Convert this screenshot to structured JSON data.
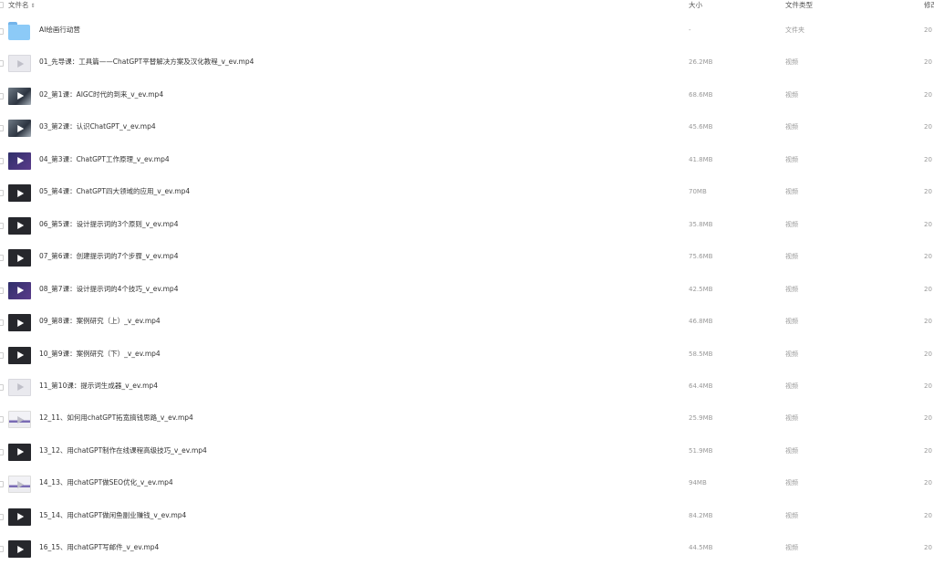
{
  "header": {
    "name": "文件名",
    "size": "大小",
    "type": "文件类型",
    "modified": "修改"
  },
  "rows": [
    {
      "name": "AI绘画行动营",
      "size": "-",
      "type": "文件夹",
      "date": "20",
      "thumb": "folder"
    },
    {
      "name": "01_先导课：工具篇——ChatGPT平替解决方案及汉化教程_v_ev.mp4",
      "size": "26.2MB",
      "type": "视频",
      "date": "20",
      "thumb": "light"
    },
    {
      "name": "02_第1课：AIGC时代的到来_v_ev.mp4",
      "size": "68.6MB",
      "type": "视频",
      "date": "20",
      "thumb": "video-img"
    },
    {
      "name": "03_第2课：认识ChatGPT_v_ev.mp4",
      "size": "45.6MB",
      "type": "视频",
      "date": "20",
      "thumb": "video-img"
    },
    {
      "name": "04_第3课：ChatGPT工作原理_v_ev.mp4",
      "size": "41.8MB",
      "type": "视频",
      "date": "20",
      "thumb": "purple"
    },
    {
      "name": "05_第4课：ChatGPT四大领域的应用_v_ev.mp4",
      "size": "70MB",
      "type": "视频",
      "date": "20",
      "thumb": "dark"
    },
    {
      "name": "06_第5课：设计提示词的3个原则_v_ev.mp4",
      "size": "35.8MB",
      "type": "视频",
      "date": "20",
      "thumb": "dark"
    },
    {
      "name": "07_第6课：创建提示词的7个步骤_v_ev.mp4",
      "size": "75.6MB",
      "type": "视频",
      "date": "20",
      "thumb": "dark"
    },
    {
      "name": "08_第7课：设计提示词的4个技巧_v_ev.mp4",
      "size": "42.5MB",
      "type": "视频",
      "date": "20",
      "thumb": "purple"
    },
    {
      "name": "09_第8课：案例研究（上）_v_ev.mp4",
      "size": "46.8MB",
      "type": "视频",
      "date": "20",
      "thumb": "dark"
    },
    {
      "name": "10_第9课：案例研究（下）_v_ev.mp4",
      "size": "58.5MB",
      "type": "视频",
      "date": "20",
      "thumb": "dark"
    },
    {
      "name": "11_第10课：提示词生成器_v_ev.mp4",
      "size": "64.4MB",
      "type": "视频",
      "date": "20",
      "thumb": "light"
    },
    {
      "name": "12_11、如何用chatGPT拓宽搞钱思路_v_ev.mp4",
      "size": "25.9MB",
      "type": "视频",
      "date": "20",
      "thumb": "screen"
    },
    {
      "name": "13_12、用chatGPT制作在线课程高级技巧_v_ev.mp4",
      "size": "51.9MB",
      "type": "视频",
      "date": "20",
      "thumb": "dark"
    },
    {
      "name": "14_13、用chatGPT做SEO优化_v_ev.mp4",
      "size": "94MB",
      "type": "视频",
      "date": "20",
      "thumb": "screen"
    },
    {
      "name": "15_14、用chatGPT做闲鱼副业赚钱_v_ev.mp4",
      "size": "84.2MB",
      "type": "视频",
      "date": "20",
      "thumb": "dark"
    },
    {
      "name": "16_15、用chatGPT写邮件_v_ev.mp4",
      "size": "44.5MB",
      "type": "视频",
      "date": "20",
      "thumb": "dark"
    }
  ]
}
